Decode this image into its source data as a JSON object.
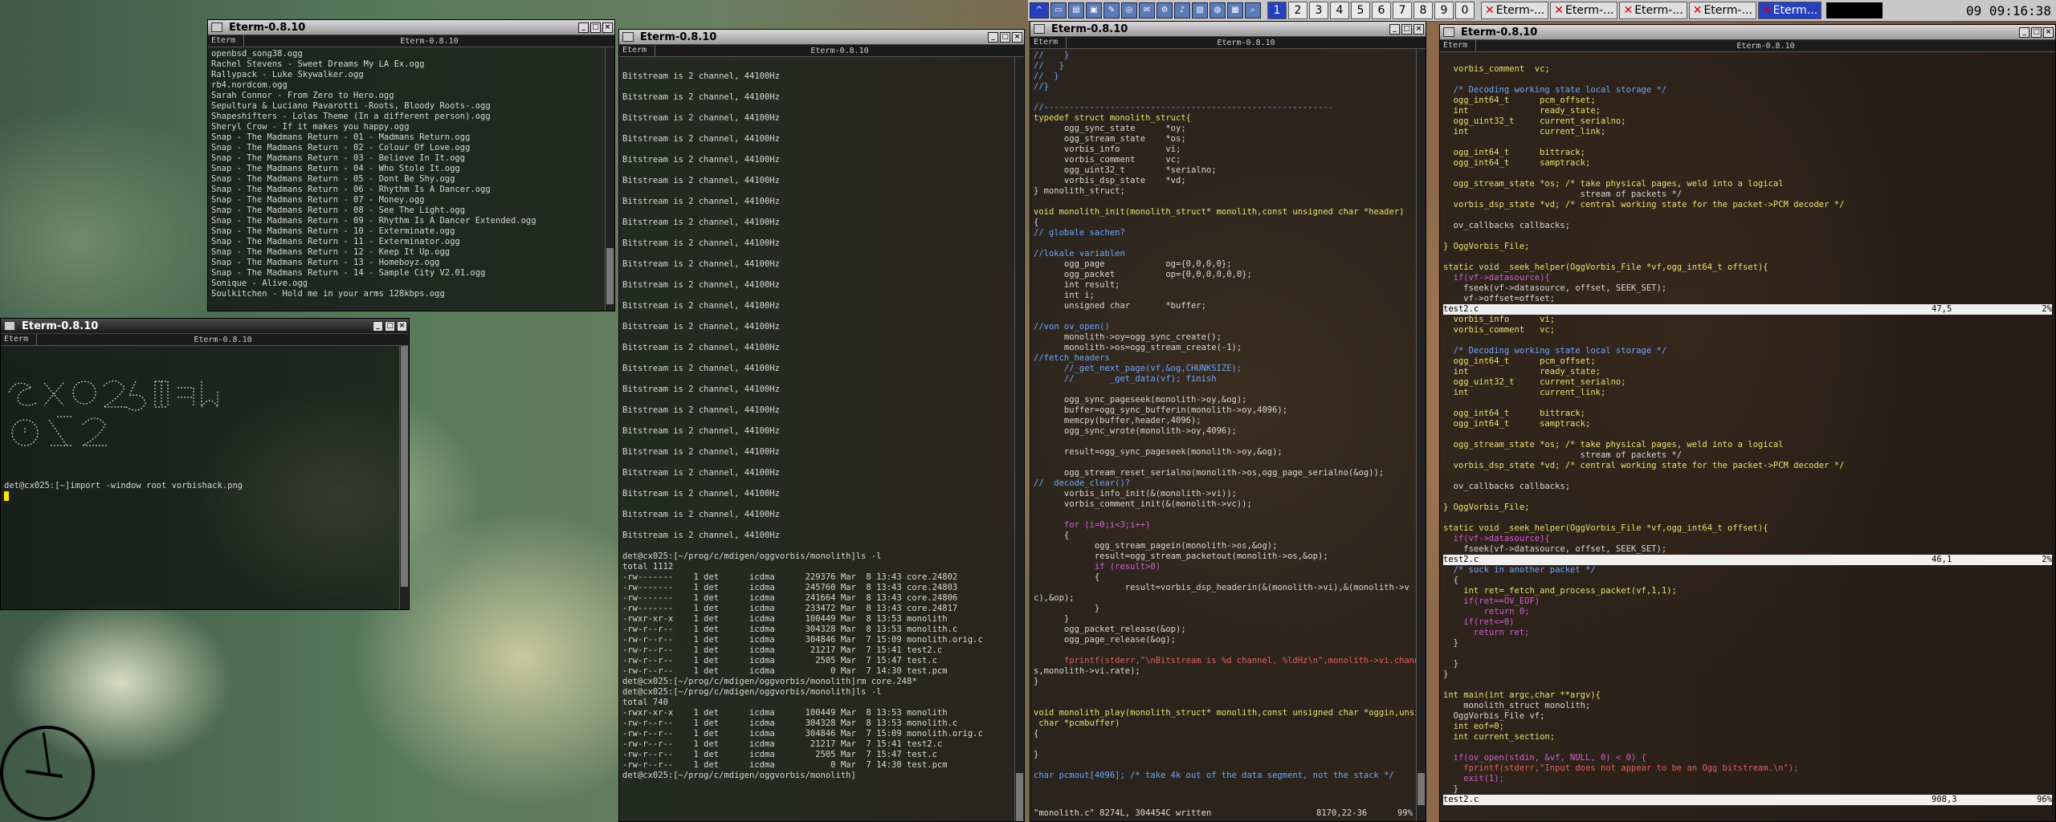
{
  "taskbar": {
    "start": "^",
    "desktops": [
      "1",
      "2",
      "3",
      "4",
      "5",
      "6",
      "7",
      "8",
      "9",
      "0"
    ],
    "active_desktop": "1",
    "tasks": [
      "Eterm-...",
      "Eterm-...",
      "Eterm-...",
      "Eterm-...",
      "Eterm..."
    ],
    "clock": "09 09:16:38"
  },
  "win_playlist": {
    "title": "Eterm-0.8.10",
    "menu_left": "Eterm",
    "menu_center": "Eterm-0.8.10",
    "lines": [
      "openbsd_song38.ogg",
      "Rachel Stevens - Sweet Dreams My LA Ex.ogg",
      "Rallypack - Luke Skywalker.ogg",
      "rb4.nordcom.ogg",
      "Sarah Connor - From Zero to Hero.ogg",
      "Sepultura & Luciano Pavarotti -Roots, Bloody Roots-.ogg",
      "Shapeshifters - Lolas Theme (In a different person).ogg",
      "Sheryl Crow - If it makes you happy.ogg",
      "Snap - The Madmans Return - 01 - Madmans Return.ogg",
      "Snap - The Madmans Return - 02 - Colour Of Love.ogg",
      "Snap - The Madmans Return - 03 - Believe In It.ogg",
      "Snap - The Madmans Return - 04 - Who Stole It.ogg",
      "Snap - The Madmans Return - 05 - Dont Be Shy.ogg",
      "Snap - The Madmans Return - 06 - Rhythm Is A Dancer.ogg",
      "Snap - The Madmans Return - 07 - Money.ogg",
      "Snap - The Madmans Return - 08 - See The Light.ogg",
      "Snap - The Madmans Return - 09 - Rhythm Is A Dancer Extended.ogg",
      "Snap - The Madmans Return - 10 - Exterminate.ogg",
      "Snap - The Madmans Return - 11 - Exterminator.ogg",
      "Snap - The Madmans Return - 12 - Keep It Up.ogg",
      "Snap - The Madmans Return - 13 - Homeboyz.ogg",
      "Snap - The Madmans Return - 14 - Sample City V2.01.ogg",
      "Sonique - Alive.ogg",
      "Soulkitchen - Hold me in your arms 128kbps.ogg"
    ]
  },
  "win_small": {
    "title": "Eterm-0.8.10",
    "menu_left": "Eterm",
    "menu_center": "Eterm-0.8.10",
    "prompt": "det@cx025:[~]import -window root vorbishack.png"
  },
  "win_bitstream": {
    "title": "Eterm-0.8.10",
    "menu_left": "Eterm",
    "menu_center": "Eterm-0.8.10",
    "bitstream_line": "Bitstream is 2 channel, 44100Hz",
    "bitstream_count": 23,
    "tail": [
      "det@cx025:[~/prog/c/mdigen/oggvorbis/monolith]ls -l",
      "total 1112",
      "-rw-------    1 det      icdma      229376 Mar  8 13:43 core.24802",
      "-rw-------    1 det      icdma      245760 Mar  8 13:43 core.24803",
      "-rw-------    1 det      icdma      241664 Mar  8 13:43 core.24806",
      "-rw-------    1 det      icdma      233472 Mar  8 13:43 core.24817",
      "-rwxr-xr-x    1 det      icdma      100449 Mar  8 13:53 monolith",
      "-rw-r--r--    1 det      icdma      304328 Mar  8 13:53 monolith.c",
      "-rw-r--r--    1 det      icdma      304846 Mar  7 15:09 monolith.orig.c",
      "-rw-r--r--    1 det      icdma       21217 Mar  7 15:41 test2.c",
      "-rw-r--r--    1 det      icdma        2505 Mar  7 15:47 test.c",
      "-rw-r--r--    1 det      icdma           0 Mar  7 14:30 test.pcm",
      "det@cx025:[~/prog/c/mdigen/oggvorbis/monolith]rm core.248*",
      "det@cx025:[~/prog/c/mdigen/oggvorbis/monolith]ls -l",
      "total 740",
      "-rwxr-xr-x    1 det      icdma      100449 Mar  8 13:53 monolith",
      "-rw-r--r--    1 det      icdma      304328 Mar  8 13:53 monolith.c",
      "-rw-r--r--    1 det      icdma      304846 Mar  7 15:09 monolith.orig.c",
      "-rw-r--r--    1 det      icdma       21217 Mar  7 15:41 test2.c",
      "-rw-r--r--    1 det      icdma        2505 Mar  7 15:47 test.c",
      "-rw-r--r--    1 det      icdma           0 Mar  7 14:30 test.pcm",
      "det@cx025:[~/prog/c/mdigen/oggvorbis/monolith]"
    ]
  },
  "win_monolith": {
    "title": "Eterm-0.8.10",
    "menu_left": "Eterm",
    "menu_center": "Eterm-0.8.10",
    "status_left": "\"monolith.c\" 8274L, 304454C written",
    "status_pos": "8170,22-36",
    "status_pct": "99%",
    "lines": [
      {
        "t": "//    }",
        "c": "cmt"
      },
      {
        "t": "//   }",
        "c": "cmt"
      },
      {
        "t": "//  }",
        "c": "cmt"
      },
      {
        "t": "//}",
        "c": "cmt"
      },
      {
        "t": "",
        "c": ""
      },
      {
        "t": "//---------------------------------------------------------",
        "c": "cmt"
      },
      {
        "t": "typedef struct monolith_struct{",
        "c": "type"
      },
      {
        "t": "      ogg_sync_state      *oy;",
        "c": ""
      },
      {
        "t": "      ogg_stream_state    *os;",
        "c": ""
      },
      {
        "t": "      vorbis_info         vi;",
        "c": ""
      },
      {
        "t": "      vorbis_comment      vc;",
        "c": ""
      },
      {
        "t": "      ogg_uint32_t        *serialno;",
        "c": ""
      },
      {
        "t": "      vorbis_dsp_state    *vd;",
        "c": ""
      },
      {
        "t": "} monolith_struct;",
        "c": ""
      },
      {
        "t": "",
        "c": ""
      },
      {
        "t": "void monolith_init(monolith_struct* monolith,const unsigned char *header)",
        "c": "type"
      },
      {
        "t": "{",
        "c": ""
      },
      {
        "t": "// globale sachen?",
        "c": "cmt"
      },
      {
        "t": "",
        "c": ""
      },
      {
        "t": "//lokale variablen",
        "c": "cmt"
      },
      {
        "t": "      ogg_page            og={0,0,0,0};",
        "c": ""
      },
      {
        "t": "      ogg_packet          op={0,0,0,0,0,0};",
        "c": ""
      },
      {
        "t": "      int result;",
        "c": ""
      },
      {
        "t": "      int i;",
        "c": ""
      },
      {
        "t": "      unsigned char       *buffer;",
        "c": ""
      },
      {
        "t": "",
        "c": ""
      },
      {
        "t": "//von ov_open()",
        "c": "cmt"
      },
      {
        "t": "      monolith->oy=ogg_sync_create();",
        "c": ""
      },
      {
        "t": "      monolith->os=ogg_stream_create(-1);",
        "c": ""
      },
      {
        "t": "//fetch_headers",
        "c": "cmt"
      },
      {
        "t": "      //_get_next_page(vf,&og,CHUNKSIZE);",
        "c": "cmt"
      },
      {
        "t": "      //       _get_data(vf); finish",
        "c": "cmt"
      },
      {
        "t": "",
        "c": ""
      },
      {
        "t": "      ogg_sync_pageseek(monolith->oy,&og);",
        "c": ""
      },
      {
        "t": "      buffer=ogg_sync_bufferin(monolith->oy,4096);",
        "c": ""
      },
      {
        "t": "      memcpy(buffer,header,4096);",
        "c": ""
      },
      {
        "t": "      ogg_sync_wrote(monolith->oy,4096);",
        "c": ""
      },
      {
        "t": "",
        "c": ""
      },
      {
        "t": "      result=ogg_sync_pageseek(monolith->oy,&og);",
        "c": ""
      },
      {
        "t": "",
        "c": ""
      },
      {
        "t": "      ogg_stream_reset_serialno(monolith->os,ogg_page_serialno(&og));",
        "c": ""
      },
      {
        "t": "//  decode_clear()?",
        "c": "cmt"
      },
      {
        "t": "      vorbis_info_init(&(monolith->vi));",
        "c": ""
      },
      {
        "t": "      vorbis_comment_init(&(monolith->vc));",
        "c": ""
      },
      {
        "t": "",
        "c": ""
      },
      {
        "t": "      for (i=0;i<3;i++)",
        "c": "kw"
      },
      {
        "t": "      {",
        "c": ""
      },
      {
        "t": "            ogg_stream_pagein(monolith->os,&og);",
        "c": ""
      },
      {
        "t": "            result=ogg_stream_packetout(monolith->os,&op);",
        "c": ""
      },
      {
        "t": "            if (result>0)",
        "c": "kw"
      },
      {
        "t": "            {",
        "c": ""
      },
      {
        "t": "                  result=vorbis_dsp_headerin(&(monolith->vi),&(monolith->v",
        "c": ""
      },
      {
        "t": "c),&op);",
        "c": ""
      },
      {
        "t": "            }",
        "c": ""
      },
      {
        "t": "      }",
        "c": ""
      },
      {
        "t": "      ogg_packet_release(&op);",
        "c": ""
      },
      {
        "t": "      ogg_page_release(&og);",
        "c": ""
      },
      {
        "t": "",
        "c": ""
      },
      {
        "t": "      fprintf(stderr,\"\\nBitstream is %d channel, %ldHz\\n\",monolith->vi.channel",
        "c": "str"
      },
      {
        "t": "s,monolith->vi.rate);",
        "c": ""
      },
      {
        "t": "}",
        "c": ""
      },
      {
        "t": "",
        "c": ""
      },
      {
        "t": "",
        "c": ""
      },
      {
        "t": "void monolith_play(monolith_struct* monolith,const unsigned char *oggin,unsigned",
        "c": "type"
      },
      {
        "t": " char *pcmbuffer)",
        "c": "type"
      },
      {
        "t": "{",
        "c": ""
      },
      {
        "t": "",
        "c": ""
      },
      {
        "t": "}",
        "c": ""
      },
      {
        "t": "",
        "c": ""
      },
      {
        "t": "char pcmout[4096]; /* take 4k out of the data segment, not the stack */",
        "c": "cmt"
      }
    ]
  },
  "win_test2": {
    "title": "Eterm-0.8.10",
    "menu_left": "Eterm",
    "menu_center": "Eterm-0.8.10",
    "pane1": [
      "  vorbis_comment  vc;",
      "",
      "  /* Decoding working state local storage */",
      "  ogg_int64_t      pcm_offset;",
      "  int              ready_state;",
      "  ogg_uint32_t     current_serialno;",
      "  int              current_link;",
      "",
      "  ogg_int64_t      bittrack;",
      "  ogg_int64_t      samptrack;",
      "",
      "  ogg_stream_state *os; /* take physical pages, weld into a logical",
      "                           stream of packets */",
      "  vorbis_dsp_state *vd; /* central working state for the packet->PCM decoder */",
      "",
      "  ov_callbacks callbacks;",
      "",
      "} OggVorbis_File;",
      "",
      "static void _seek_helper(OggVorbis_File *vf,ogg_int64_t offset){",
      "  if(vf->datasource){",
      "    fseek(vf->datasource, offset, SEEK_SET);",
      "    vf->offset=offset;"
    ],
    "status1_left": "test2.c",
    "status1_pos": "47,5",
    "status1_pct": "2%",
    "pane2": [
      "  vorbis_info      vi;",
      "  vorbis_comment   vc;",
      "",
      "  /* Decoding working state local storage */",
      "  ogg_int64_t      pcm_offset;",
      "  int              ready_state;",
      "  ogg_uint32_t     current_serialno;",
      "  int              current_link;",
      "",
      "  ogg_int64_t      bittrack;",
      "  ogg_int64_t      samptrack;",
      "",
      "  ogg_stream_state *os; /* take physical pages, weld into a logical",
      "                           stream of packets */",
      "  vorbis_dsp_state *vd; /* central working state for the packet->PCM decoder */",
      "",
      "  ov_callbacks callbacks;",
      "",
      "} OggVorbis_File;",
      "",
      "static void _seek_helper(OggVorbis_File *vf,ogg_int64_t offset){",
      "  if(vf->datasource){",
      "    fseek(vf->datasource, offset, SEEK_SET);"
    ],
    "status2_left": "test2.c",
    "status2_pos": "46,1",
    "status2_pct": "2%",
    "pane3": [
      "  /* suck in another packet */",
      "  {",
      "    int ret=_fetch_and_process_packet(vf,1,1);",
      "    if(ret==OV_EOF)",
      "        return 0;",
      "    if(ret<=0)",
      "      return ret;",
      "  }",
      "",
      "  }",
      "}",
      "",
      "int main(int argc,char **argv){",
      "    monolith_struct monolith;",
      "  OggVorbis_File vf;",
      "  int eof=0;",
      "  int current_section;",
      "",
      "  if(ov_open(stdin, &vf, NULL, 0) < 0) {",
      "    fprintf(stderr,\"Input does not appear to be an Ogg bitstream.\\n\");",
      "    exit(1);",
      "  }"
    ],
    "status3_left": "test2.c",
    "status3_pos": "908,3",
    "status3_pct": "96%"
  },
  "colors": {
    "comment": "#6ea8ff",
    "type": "#e8e070",
    "keyword": "#d060d0",
    "string": "#e06060"
  }
}
